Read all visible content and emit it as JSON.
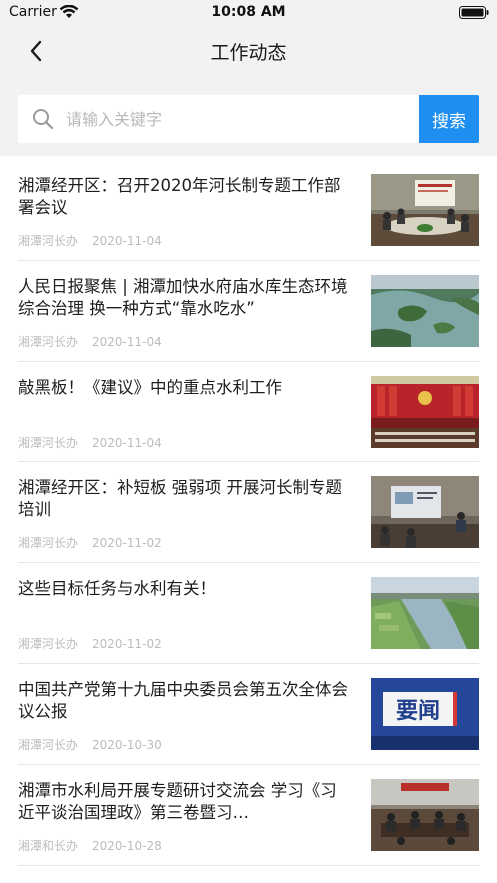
{
  "status_bar": {
    "carrier": "Carrier",
    "time": "10:08 AM"
  },
  "nav": {
    "title": "工作动态"
  },
  "search": {
    "placeholder": "请输入关键字",
    "button_label": "搜索"
  },
  "news": [
    {
      "title": "湘潭经开区：召开2020年河长制专题工作部署会议",
      "source": "湘潭河长办",
      "date": "2020-11-04",
      "image": "meeting-room-photo"
    },
    {
      "title": "人民日报聚焦 | 湘潭加快水府庙水库生态环境综合治理 换一种方式“靠水吃水”",
      "source": "湘潭河长办",
      "date": "2020-11-04",
      "image": "reservoir-aerial-photo"
    },
    {
      "title": "敲黑板！《建议》中的重点水利工作",
      "source": "湘潭河长办",
      "date": "2020-11-04",
      "image": "plenary-session-photo"
    },
    {
      "title": "湘潭经开区：补短板 强弱项 开展河长制专题培训",
      "source": "湘潭河长办",
      "date": "2020-11-02",
      "image": "training-session-photo"
    },
    {
      "title": "这些目标任务与水利有关！",
      "source": "湘潭河长办",
      "date": "2020-11-02",
      "image": "river-landscape-photo"
    },
    {
      "title": "中国共产党第十九届中央委员会第五次全体会议公报",
      "source": "湘潭河长办",
      "date": "2020-10-30",
      "image": "headline-news-graphic",
      "image_text": "要闻"
    },
    {
      "title": "湘潭市水利局开展专题研讨交流会 学习《习近平谈治国理政》第三卷暨习…",
      "source": "湘潭和长办",
      "date": "2020-10-28",
      "image": "seminar-photo"
    }
  ]
}
